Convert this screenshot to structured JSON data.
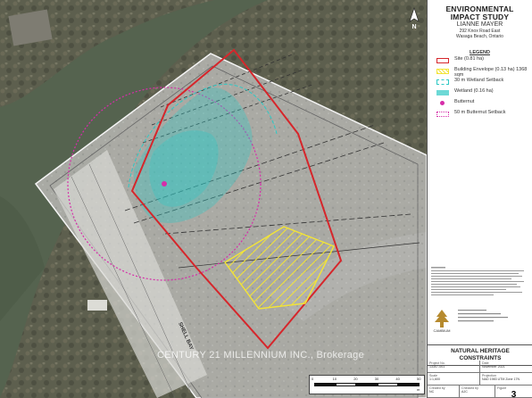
{
  "panel": {
    "title_line1": "ENVIRONMENTAL",
    "title_line2": "IMPACT STUDY",
    "client": "LIANNE MAYER",
    "address_line1": "292 Knox Road East",
    "address_line2": "Wasaga Beach, Ontario",
    "legend_title": "LEGEND",
    "legend": [
      {
        "label": "Site (0.81 ha)",
        "color": "#d6262b",
        "style": "outline"
      },
      {
        "label": "Building Envelope (0.13 ha) 1368 sqm",
        "color": "#f3e436",
        "style": "hatch"
      },
      {
        "label": "30 m Wetland Setback",
        "color": "#2fc9c5",
        "style": "dash"
      },
      {
        "label": "Wetland (0.16 ha)",
        "color": "#2fc9c5",
        "style": "fill"
      },
      {
        "label": "Butternut",
        "color": "#d62da9",
        "style": "dot"
      },
      {
        "label": "50 m Butternut Setback",
        "color": "#d62da9",
        "style": "dotted"
      }
    ],
    "figure_title_line1": "NATURAL HERITAGE",
    "figure_title_line2": "CONSTRAINTS",
    "project_label": "Project No.",
    "project_no": "13307-001",
    "date_label": "Date",
    "date_value": "November 2021",
    "scale_label": "Scale",
    "scale_value": "1:1,600",
    "projection_label": "Projection",
    "projection_value": "NAD 1983 UTM Zone 17N",
    "created_label": "Created by",
    "created_value": "NC",
    "checked_label": "Checked by",
    "checked_value": "AJC",
    "figure_label": "Figure",
    "figure_value": "3",
    "logo_text": "CAMBIUM"
  },
  "map": {
    "watermark": "CENTURY 21 MILLENNIUM INC., Brokerage",
    "north_arrow": "N",
    "scale_unit": "m",
    "scale_ticks": [
      "0",
      "10",
      "20",
      "30",
      "40",
      "50"
    ],
    "road_label": "SHELL BAY",
    "colors": {
      "site": "#d6262b",
      "envelope": "#f3e436",
      "wetland": "#2fc9c5",
      "butternut": "#d62da9",
      "water": "#5c6b55",
      "survey_overlay": "#c9c9c9"
    }
  }
}
